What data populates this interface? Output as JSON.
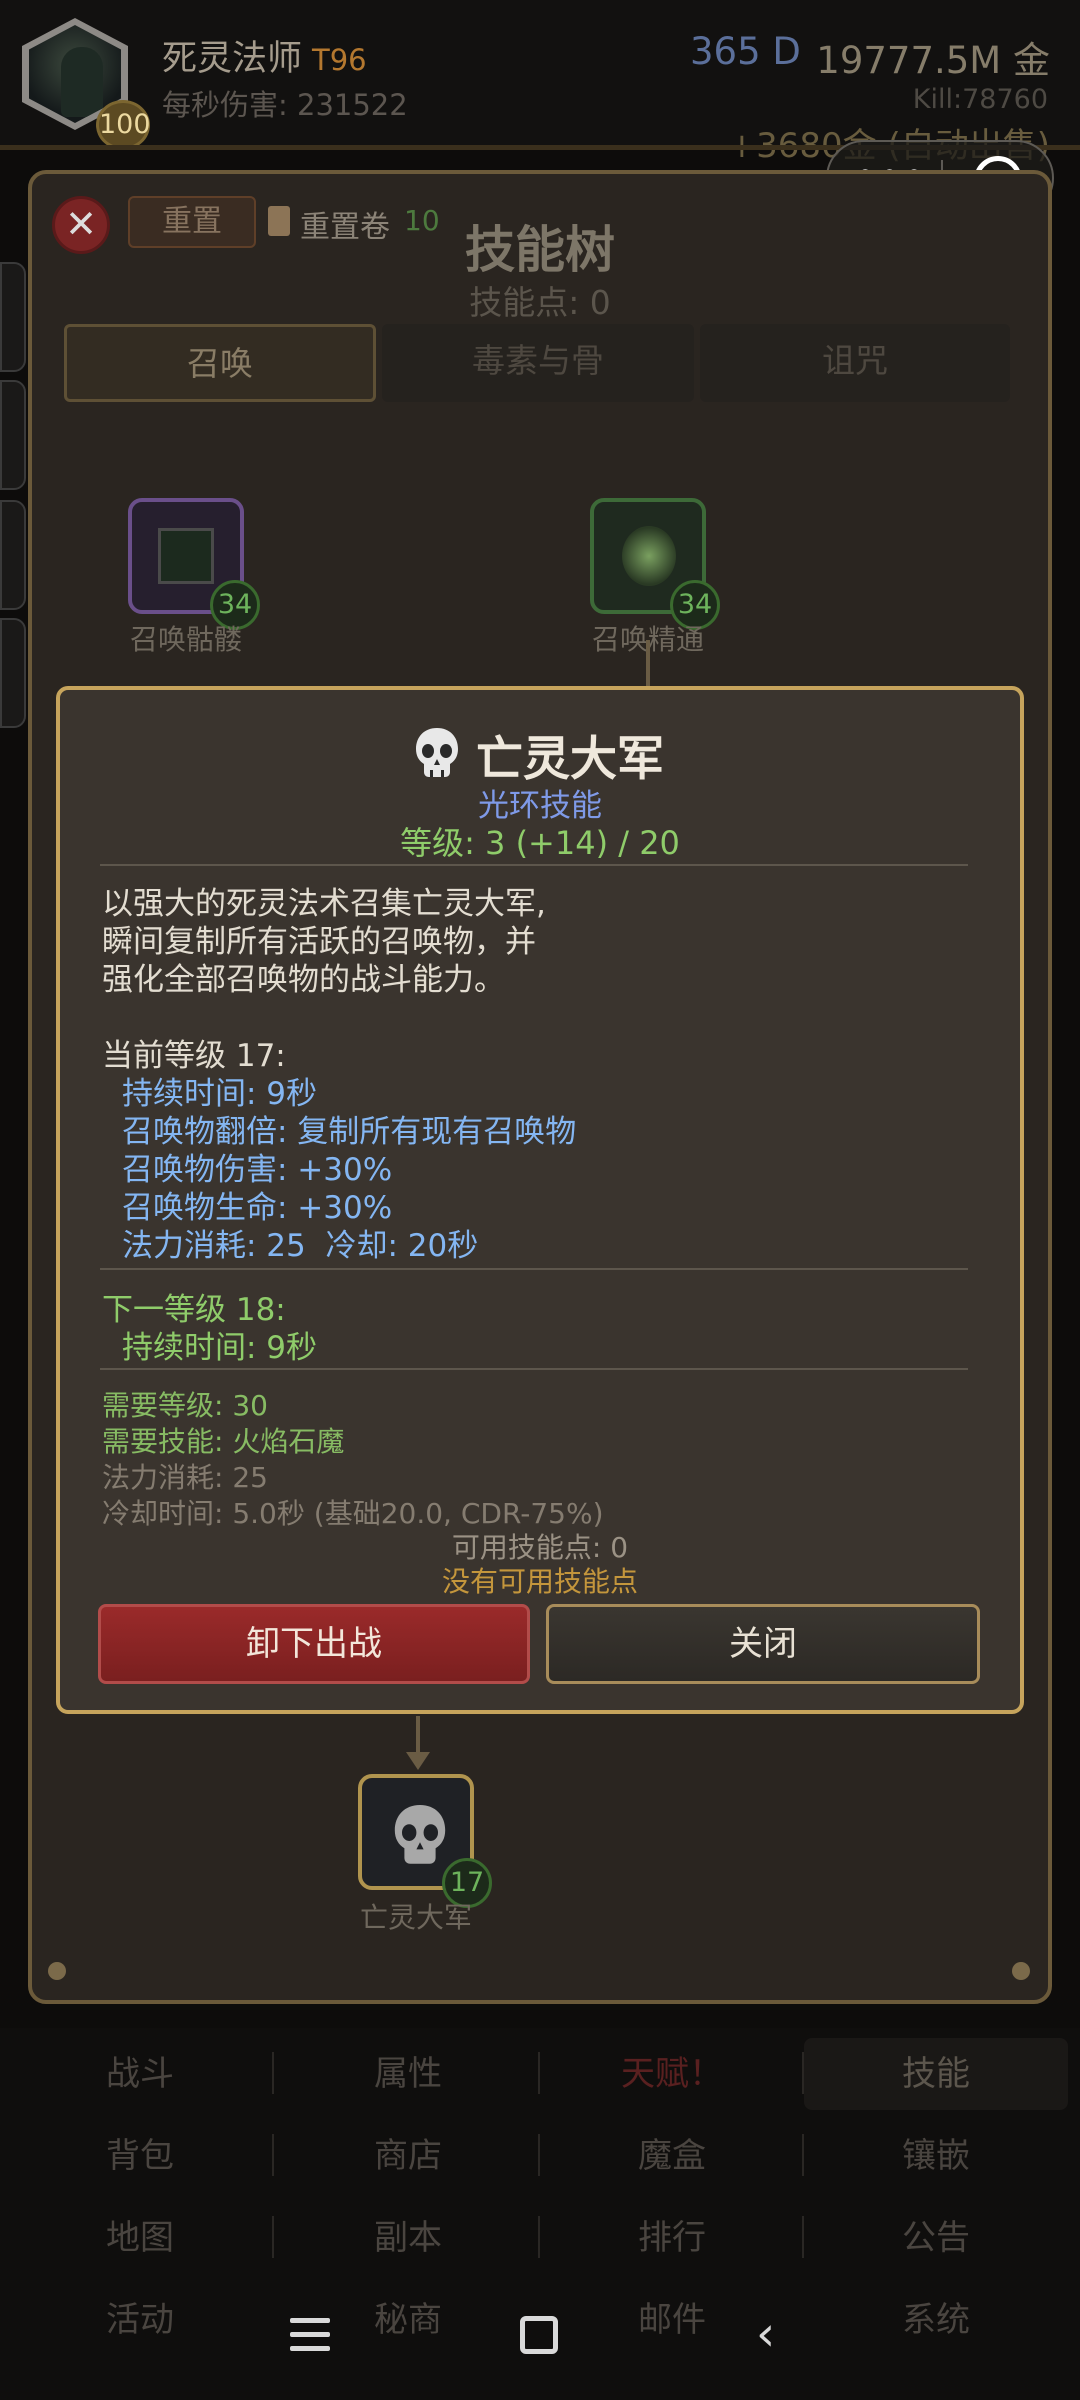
{
  "header": {
    "character_name": "死灵法师",
    "tier": "T96",
    "level_badge": "100",
    "dps_text": "每秒伤害: 231522",
    "days": "365 D",
    "gold": "19777.5M 金",
    "kills": "Kill:78760",
    "gold_gain": "+3680金 (自动出售)"
  },
  "skill_tree": {
    "reset_label": "重置",
    "reset_scroll_label": "重置卷",
    "reset_scroll_count": "10",
    "title": "技能树",
    "skill_points_text": "技能点: 0",
    "tabs": [
      {
        "label": "召唤",
        "active": true
      },
      {
        "label": "毒素与骨",
        "active": false
      },
      {
        "label": "诅咒",
        "active": false
      }
    ],
    "nodes": [
      {
        "label": "召唤骷髅",
        "level": "34",
        "icon": "skeleton-portrait-icon"
      },
      {
        "label": "召唤精通",
        "level": "34",
        "icon": "green-skull-icon"
      },
      {
        "label": "亡灵大军",
        "level": "17",
        "icon": "skull-icon"
      }
    ]
  },
  "detail": {
    "title": "亡灵大军",
    "subtitle": "光环技能",
    "level_text": "等级: 3 (+14) / 20",
    "description_lines": [
      "以强大的死灵法术召集亡灵大军,",
      "瞬间复制所有活跃的召唤物，并",
      "强化全部召唤物的战斗能力。"
    ],
    "current_header": "当前等级 17:",
    "current_stats": [
      "持续时间: 9秒",
      "召唤物翻倍: 复制所有现有召唤物",
      "召唤物伤害: +30%",
      "召唤物生命: +30%",
      "法力消耗: 25  冷却: 20秒"
    ],
    "next_header": "下一等级 18:",
    "next_stats": [
      "持续时间: 9秒"
    ],
    "requirements_green": [
      "需要等级: 30",
      "需要技能: 火焰石魔"
    ],
    "requirements_gray": [
      "法力消耗: 25",
      "冷却时间: 5.0秒 (基础20.0, CDR-75%)"
    ],
    "available_points": "可用技能点: 0",
    "no_points": "没有可用技能点",
    "unequip_label": "卸下出战",
    "close_label": "关闭"
  },
  "bottom_nav": {
    "rows": [
      [
        "战斗",
        "属性",
        "天赋！",
        "技能"
      ],
      [
        "背包",
        "商店",
        "魔盒",
        "镶嵌"
      ],
      [
        "地图",
        "副本",
        "排行",
        "公告"
      ],
      [
        "活动",
        "秘商",
        "邮件",
        "系统"
      ]
    ]
  },
  "colors": {
    "accent_gold": "#c6a45c",
    "aura_blue": "#7f9ae8",
    "level_green": "#8fcc6a",
    "stat_blue": "#84b6f2",
    "danger_red": "#9a2a2a"
  }
}
